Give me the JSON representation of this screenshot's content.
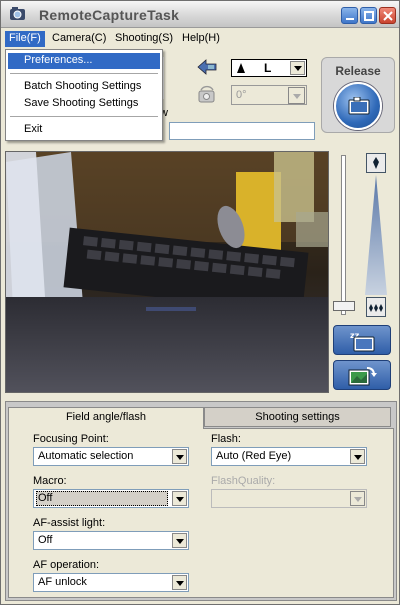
{
  "window": {
    "title": "RemoteCaptureTask"
  },
  "menubar": {
    "items": [
      "File(F)",
      "Camera(C)",
      "Shooting(S)",
      "Help(H)"
    ]
  },
  "file_menu": {
    "items": [
      "Preferences...",
      "Batch Shooting Settings",
      "Save Shooting Settings",
      "Exit"
    ],
    "highlighted": "Preferences..."
  },
  "toolbar": {
    "image_quality": "L",
    "rotation": "0°",
    "release_label": "Release",
    "partial_label_right": "w"
  },
  "tabs": {
    "active": "Field angle/flash",
    "inactive": "Shooting settings"
  },
  "settings": {
    "focusing_point": {
      "label": "Focusing Point:",
      "value": "Automatic selection"
    },
    "flash": {
      "label": "Flash:",
      "value": "Auto (Red Eye)"
    },
    "macro": {
      "label": "Macro:",
      "value": "Off"
    },
    "flash_quality": {
      "label": "FlashQuality:",
      "value": ""
    },
    "af_assist": {
      "label": "AF-assist light:",
      "value": "Off"
    },
    "af_operation": {
      "label": "AF operation:",
      "value": "AF unlock"
    }
  },
  "colors": {
    "menu_highlight": "#316ac5",
    "window_bg": "#ece9d8",
    "accent_blue": "#2f69b8"
  }
}
